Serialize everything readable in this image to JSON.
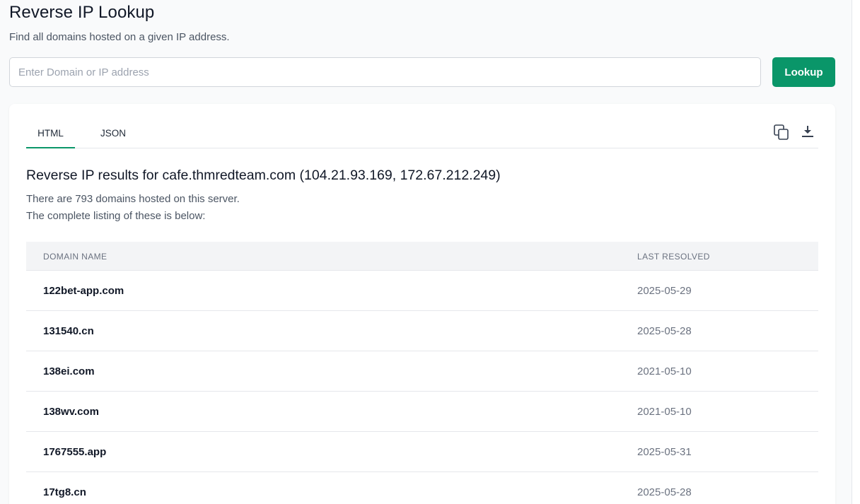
{
  "header": {
    "title": "Reverse IP Lookup",
    "subtitle": "Find all domains hosted on a given IP address."
  },
  "search": {
    "placeholder": "Enter Domain or IP address",
    "value": "",
    "button_label": "Lookup"
  },
  "colors": {
    "accent": "#0a9669"
  },
  "tabs": [
    {
      "label": "HTML",
      "active": true
    },
    {
      "label": "JSON",
      "active": false
    }
  ],
  "toolbar": {
    "copy_icon": "copy-icon",
    "download_icon": "download-icon"
  },
  "results": {
    "heading": "Reverse IP results for cafe.thmredteam.com (104.21.93.169, 172.67.212.249)",
    "count_text": "There are 793 domains hosted on this server.",
    "listing_text": "The complete listing of these is below:"
  },
  "table": {
    "columns": [
      "DOMAIN NAME",
      "LAST RESOLVED"
    ],
    "rows": [
      {
        "domain": "122bet-app.com",
        "last_resolved": "2025-05-29"
      },
      {
        "domain": "131540.cn",
        "last_resolved": "2025-05-28"
      },
      {
        "domain": "138ei.com",
        "last_resolved": "2021-05-10"
      },
      {
        "domain": "138wv.com",
        "last_resolved": "2021-05-10"
      },
      {
        "domain": "1767555.app",
        "last_resolved": "2025-05-31"
      },
      {
        "domain": "17tg8.cn",
        "last_resolved": "2025-05-28"
      }
    ]
  }
}
